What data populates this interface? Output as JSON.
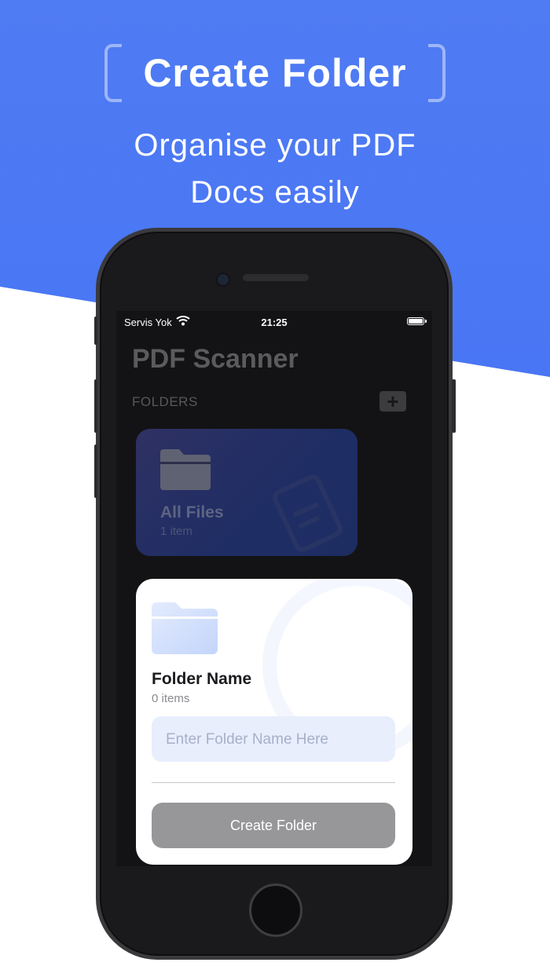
{
  "promo": {
    "headline": "Create Folder",
    "subhead_line1": "Organise your PDF",
    "subhead_line2": "Docs easily"
  },
  "status_bar": {
    "carrier": "Servis Yok",
    "time": "21:25"
  },
  "app": {
    "title": "PDF Scanner",
    "folders_label": "FOLDERS",
    "add_button_label": "+",
    "folder_card": {
      "title": "All Files",
      "count": "1 item"
    }
  },
  "create_sheet": {
    "title": "Folder Name",
    "count": "0 items",
    "input_placeholder": "Enter Folder Name Here",
    "input_value": "",
    "create_button_label": "Create Folder"
  },
  "colors": {
    "brand_blue": "#4f7bf3",
    "card_gradient": "#2f3163",
    "button_gray": "#979799"
  }
}
